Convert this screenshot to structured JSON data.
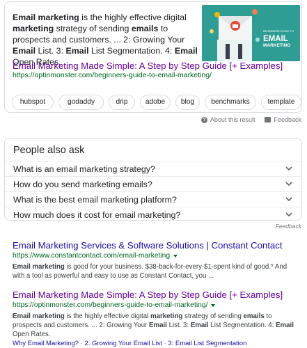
{
  "featured_snippet": {
    "text_parts": [
      {
        "t": "Email marketing",
        "b": true
      },
      {
        "t": " is the highly effective digital ",
        "b": false
      },
      {
        "t": "marketing",
        "b": true
      },
      {
        "t": " strategy of sending ",
        "b": false
      },
      {
        "t": "emails",
        "b": true
      },
      {
        "t": " to prospects and customers. ... 2: Growing Your ",
        "b": false
      },
      {
        "t": "Email",
        "b": true
      },
      {
        "t": " List. 3: ",
        "b": false
      },
      {
        "t": "Email",
        "b": true
      },
      {
        "t": " List Segmentation. 4: ",
        "b": false
      },
      {
        "t": "Email",
        "b": true
      },
      {
        "t": " Open Rates.",
        "b": false
      }
    ],
    "image": {
      "small_text": "BEGINNERS GUIDE TO",
      "big_text": "EMAIL",
      "sub_text": "MARKETING",
      "bg_color": "#2e9d93"
    },
    "title": "Email Marketing Made Simple: A Step by Step Guide [+ Examples]",
    "url": "https://optinmonster.com/beginners-guide-to-email-marketing/",
    "chips": [
      "hubspot",
      "godaddy",
      "drip",
      "adobe",
      "blog",
      "benchmarks",
      "template"
    ]
  },
  "about": {
    "about_label": "About this result",
    "feedback_label": "Feedback"
  },
  "paa": {
    "heading": "People also ask",
    "questions": [
      "What is an email marketing strategy?",
      "How do you send marketing emails?",
      "What is the best email marketing platform?",
      "How much does it cost for email marketing?"
    ],
    "feedback_label": "Feedback"
  },
  "results": [
    {
      "title": "Email Marketing Services & Software Solutions | Constant Contact",
      "url": "https://www.constantcontact.com/email-marketing",
      "snippet_parts": [
        {
          "t": "Email marketing",
          "b": true
        },
        {
          "t": " is good for your business. $38-back-for-every-$1-spent kind of good.* And with a tool as powerful and easy to use as Constant Contact, you ...",
          "b": false
        }
      ]
    },
    {
      "title": "Email Marketing Made Simple: A Step by Step Guide [+ Examples]",
      "url": "https://optinmonster.com/beginners-guide-to-email-marketing/",
      "snippet_parts": [
        {
          "t": "Email marketing",
          "b": true
        },
        {
          "t": " is the highly effective digital ",
          "b": false
        },
        {
          "t": "marketing",
          "b": true
        },
        {
          "t": " strategy of sending ",
          "b": false
        },
        {
          "t": "emails",
          "b": true
        },
        {
          "t": " to prospects and customers. ... 2: Growing Your ",
          "b": false
        },
        {
          "t": "Email",
          "b": true
        },
        {
          "t": " List. 3: ",
          "b": false
        },
        {
          "t": "Email",
          "b": true
        },
        {
          "t": " List Segmentation. 4: ",
          "b": false
        },
        {
          "t": "Email",
          "b": true
        },
        {
          "t": " Open Rates.",
          "b": false
        }
      ],
      "sitelinks": [
        "Why Email Marketing?",
        "2: Growing Your Email List",
        "3: Email List Segmentation"
      ],
      "sitelink_separator": " · "
    }
  ]
}
